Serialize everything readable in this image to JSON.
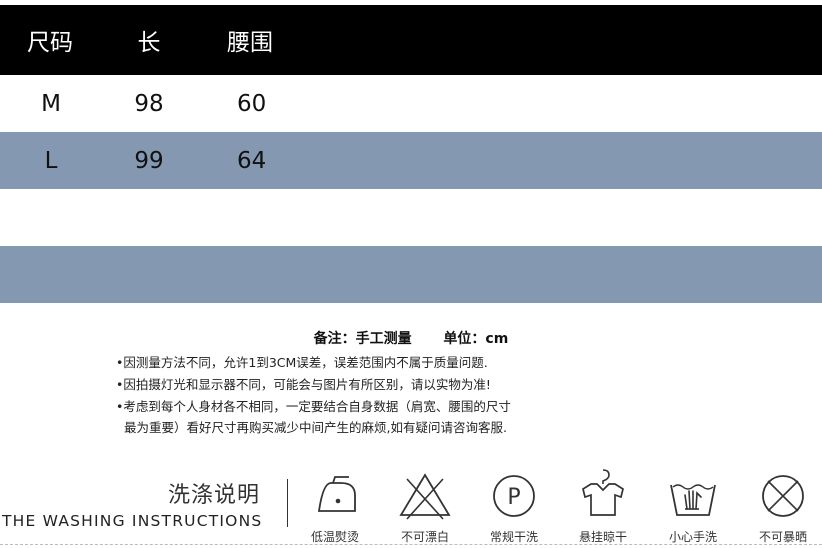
{
  "size_table": {
    "headers": [
      "尺码",
      "长",
      "腰围"
    ],
    "rows": [
      [
        "M",
        "98",
        "60"
      ],
      [
        "L",
        "99",
        "64"
      ]
    ],
    "colors": {
      "header_bg": "#000000",
      "stripe_bg": "#8598b2"
    }
  },
  "notes": {
    "title": "备注：手工测量",
    "unit": "单位：cm",
    "lines": [
      "•因测量方法不同，允许1到3CM误差，误差范围内不属于质量问题.",
      "•因拍摄灯光和显示器不同，可能会与图片有所区别，请以实物为准!",
      "•考虑到每个人身材各不相同，一定要结合自身数据（肩宽、腰围的尺寸",
      "最为重要）看好尺寸再购买减少中间产生的麻烦,如有疑问请咨询客服."
    ]
  },
  "washing": {
    "title_cn": "洗涤说明",
    "title_en": "THE WASHING INSTRUCTIONS",
    "items": [
      {
        "icon": "iron-icon",
        "label": "低温熨烫"
      },
      {
        "icon": "no-bleach-icon",
        "label": "不可漂白"
      },
      {
        "icon": "dry-clean-p-icon",
        "label": "常规干洗"
      },
      {
        "icon": "hang-dry-icon",
        "label": "悬挂晾干"
      },
      {
        "icon": "hand-wash-icon",
        "label": "小心手洗"
      },
      {
        "icon": "no-sun-dry-icon",
        "label": "不可暴晒"
      }
    ]
  }
}
